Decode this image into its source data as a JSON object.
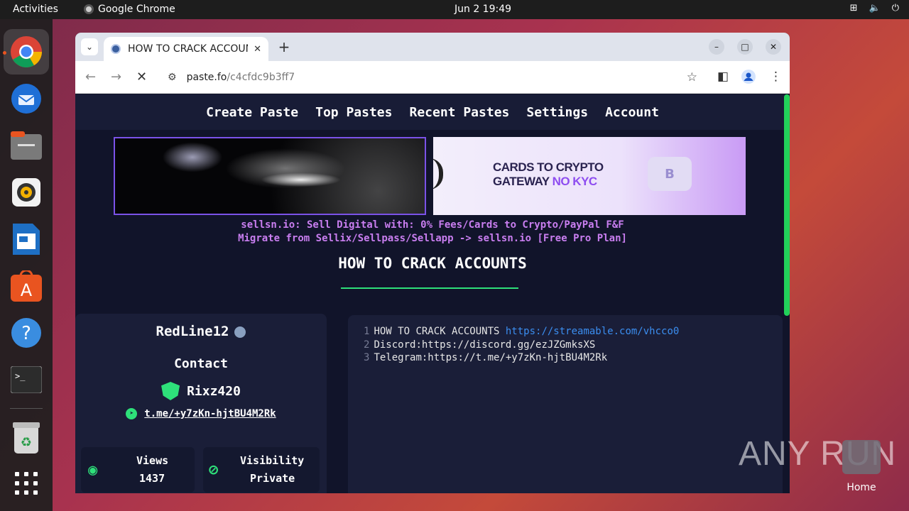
{
  "topbar": {
    "activities": "Activities",
    "app_name": "Google Chrome",
    "clock": "Jun 2  19:49"
  },
  "dock": {
    "items": [
      "chrome-icon",
      "thunderbird-icon",
      "files-icon",
      "rhythmbox-icon",
      "writer-icon",
      "app-center-icon",
      "help-icon",
      "terminal-icon",
      "trash-icon",
      "app-grid-icon"
    ]
  },
  "browser": {
    "tab_title": "HOW TO CRACK ACCOUNTS",
    "url_host": "paste.fo",
    "url_path": "/c4cfdc9b3ff7"
  },
  "site": {
    "nav": [
      "Create Paste",
      "Top Pastes",
      "Recent Pastes",
      "Settings",
      "Account"
    ],
    "banner_right": {
      "line1": "CARDS TO CRYPTO",
      "line2_a": "GATEWAY",
      "line2_b": "NO KYC",
      "coin": "B"
    },
    "promo_1": "sellsn.io: Sell Digital with: 0% Fees/Cards to Crypto/PayPal F&F",
    "promo_2": "Migrate from Sellix/Sellpass/Sellapp -> sellsn.io [Free Pro Plan]",
    "paste_title": "HOW TO CRACK ACCOUNTS",
    "author": "RedLine12",
    "contact_label": "Contact",
    "contact_name": "Rixz420",
    "telegram": "t.me/+y7zKn-hjtBU4M2Rk",
    "views_label": "Views",
    "views_value": "1437",
    "visibility_label": "Visibility",
    "visibility_value": "Private",
    "code_lines": [
      {
        "n": "1",
        "text": "HOW TO CRACK ACCOUNTS ",
        "link": "https://streamable.com/vhcco0"
      },
      {
        "n": "2",
        "text": "Discord:https://discord.gg/ezJZGmksXS",
        "link": ""
      },
      {
        "n": "3",
        "text": "Telegram:https://t.me/+y7zKn-hjtBU4M2Rk",
        "link": ""
      }
    ]
  },
  "desktop": {
    "watermark": "ANY RUN",
    "home_label": "Home"
  }
}
